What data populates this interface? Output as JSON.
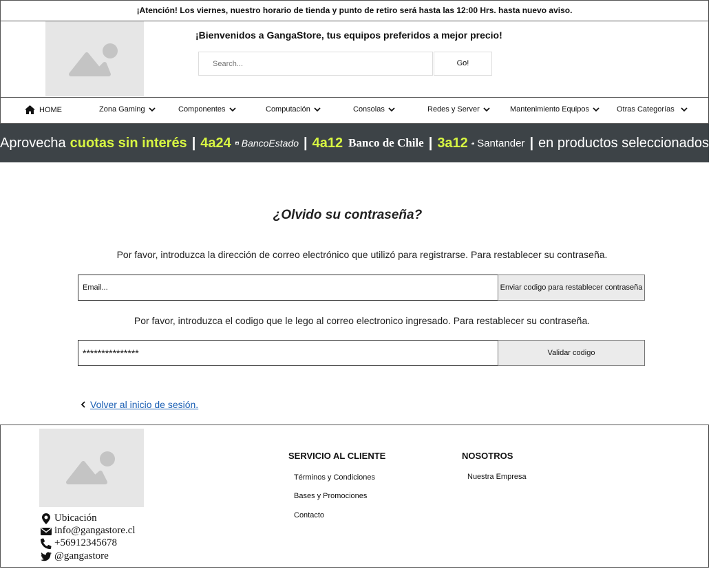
{
  "notice": "¡Atención! Los viernes, nuestro horario de tienda y punto de retiro será hasta las 12:00 Hrs. hasta nuevo aviso.",
  "header": {
    "welcome": "¡Bienvenidos a GangaStore, tus equipos preferidos a mejor precio!",
    "search_placeholder": "Search...",
    "search_button": "Go!"
  },
  "nav": {
    "home": "HOME",
    "items": [
      "Zona Gaming",
      "Componentes",
      "Computación",
      "Consolas",
      "Redes y Server",
      "Mantenimiento Equipos",
      "Otras Categorías"
    ]
  },
  "banner": {
    "lead": "Aprovecha",
    "highlight": "cuotas sin interés",
    "offer1": "4a24",
    "bank1": "BancoEstado",
    "offer2": "4a12",
    "bank2": "Banco de Chile",
    "offer3": "3a12",
    "bank3": "Santander",
    "tail": "en productos seleccionados"
  },
  "main": {
    "title": "¿Olvido su contraseña?",
    "email_instructions": "Por favor, introduzca la dirección de correo electrónico que utilizó para registrarse. Para restablecer su contraseña.",
    "email_placeholder": "Email...",
    "send_code_button": "Enviar codigo para restablecer contraseña",
    "code_instructions": "Por favor, introduzca el codigo que le lego al correo electronico ingresado. Para restablecer su contraseña.",
    "code_value": "***************",
    "validate_button": "Validar codigo",
    "back_link": "Volver al inicio de sesión."
  },
  "footer": {
    "location": "Ubicación",
    "email": "info@gangastore.cl",
    "phone": "+56912345678",
    "twitter": "@gangastore",
    "service_title": "SERVICIO AL CLIENTE",
    "service_links": [
      "Términos y Condiciones",
      "Bases y Promociones",
      "Contacto"
    ],
    "about_title": "NOSOTROS",
    "about_links": [
      "Nuestra Empresa"
    ]
  }
}
